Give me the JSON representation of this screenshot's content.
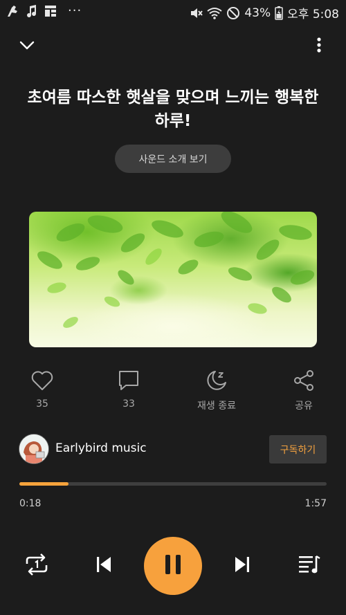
{
  "status_bar": {
    "battery": "43%",
    "time": "오후 5:08",
    "overflow": "···",
    "icons": [
      "headphone-app-icon",
      "music-note-icon",
      "grid-icon",
      "mute-icon",
      "wifi-icon",
      "do-not-disturb-icon",
      "battery-icon"
    ]
  },
  "header": {
    "collapse_icon": "chevron-down-icon",
    "more_icon": "more-vertical-icon"
  },
  "title": "초여름 따스한 햇살을 맞으며 느끼는 행복한 하루!",
  "intro_button": "사운드 소개 보기",
  "actions": [
    {
      "icon": "heart-icon",
      "label": "35"
    },
    {
      "icon": "comment-icon",
      "label": "33"
    },
    {
      "icon": "sleep-timer-icon",
      "label": "재생 종료"
    },
    {
      "icon": "share-icon",
      "label": "공유"
    }
  ],
  "channel": {
    "name": "Earlybird music",
    "subscribe_label": "구독하기"
  },
  "player": {
    "elapsed": "0:18",
    "duration": "1:57",
    "progress_fraction": 0.16,
    "accent_color": "#f5a33c"
  },
  "controls": [
    "repeat-one-icon",
    "previous-icon",
    "pause-icon",
    "next-icon",
    "playlist-icon"
  ]
}
